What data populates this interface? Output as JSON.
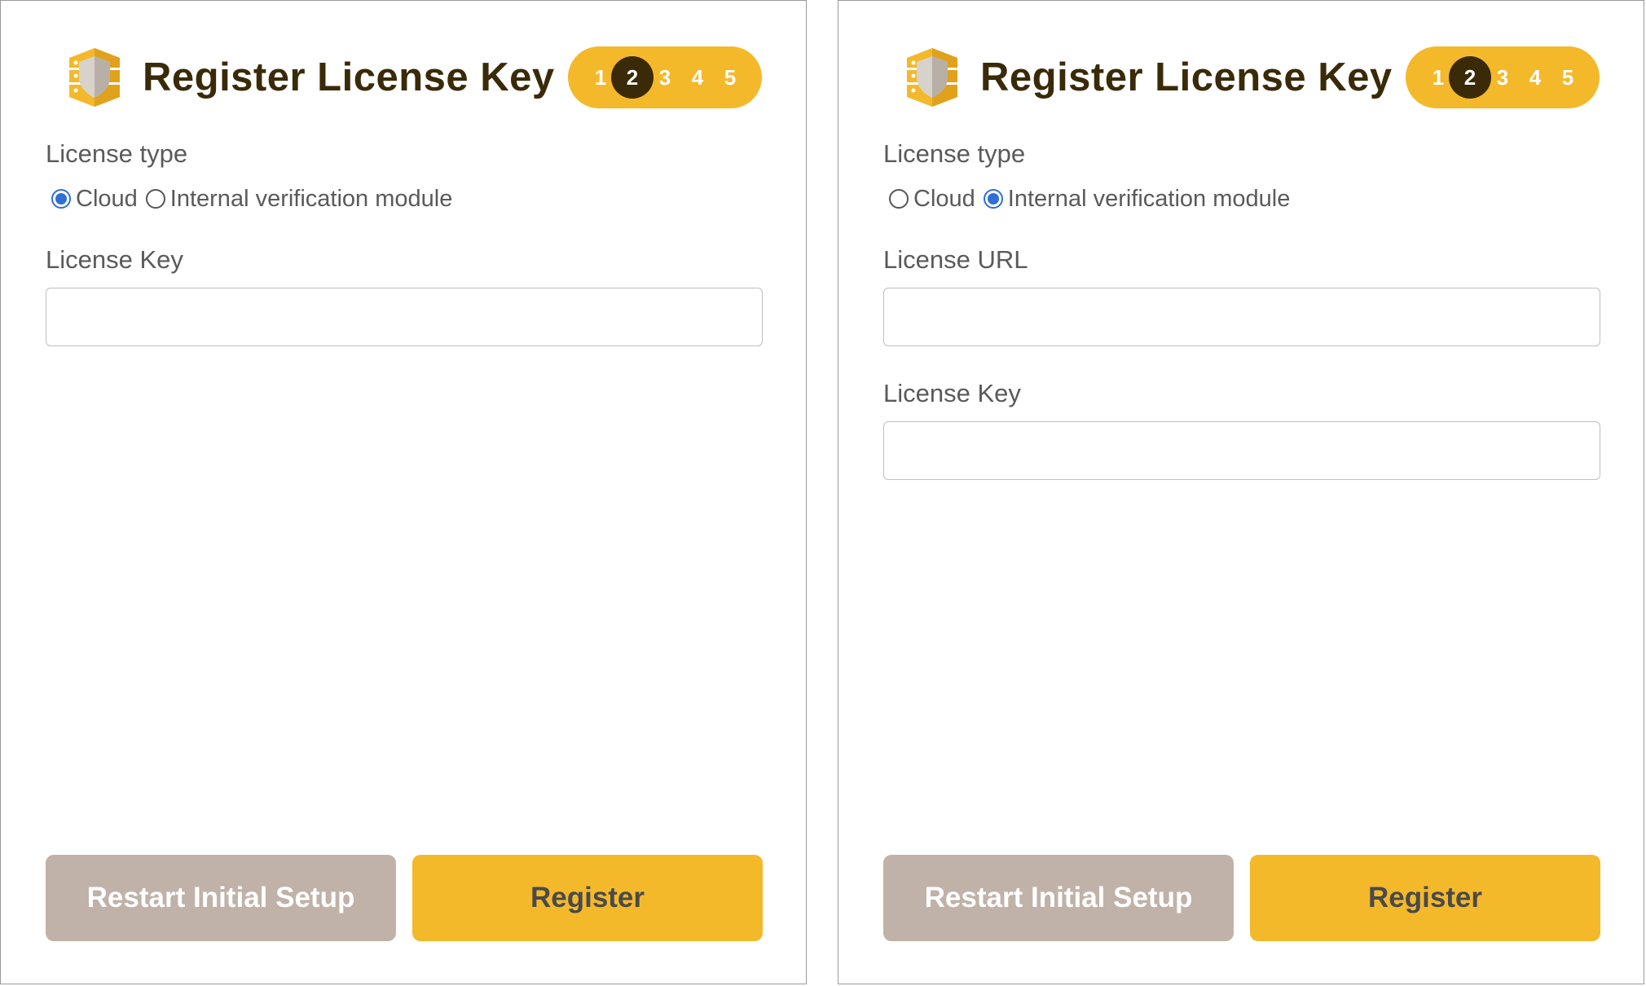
{
  "colors": {
    "accent": "#f4b92b",
    "step_active": "#3a2a08",
    "restart_button": "#c0b2a8",
    "radio_selected": "#2f6fd6"
  },
  "panels": [
    {
      "logo_icon": "shield-server-icon",
      "title": "Register License Key",
      "steps": [
        "1",
        "2",
        "3",
        "4",
        "5"
      ],
      "active_step": "2",
      "license_type_label": "License type",
      "options": [
        {
          "label": "Cloud",
          "checked": true
        },
        {
          "label": "Internal verification module",
          "checked": false
        }
      ],
      "license_key_label": "License Key",
      "license_key_value": "",
      "restart_label": "Restart Initial Setup",
      "register_label": "Register"
    },
    {
      "logo_icon": "shield-server-icon",
      "title": "Register License Key",
      "steps": [
        "1",
        "2",
        "3",
        "4",
        "5"
      ],
      "active_step": "2",
      "license_type_label": "License type",
      "options": [
        {
          "label": "Cloud",
          "checked": false
        },
        {
          "label": "Internal verification module",
          "checked": true
        }
      ],
      "license_url_label": "License URL",
      "license_url_value": "",
      "license_key_label": "License Key",
      "license_key_value": "",
      "restart_label": "Restart Initial Setup",
      "register_label": "Register"
    }
  ]
}
